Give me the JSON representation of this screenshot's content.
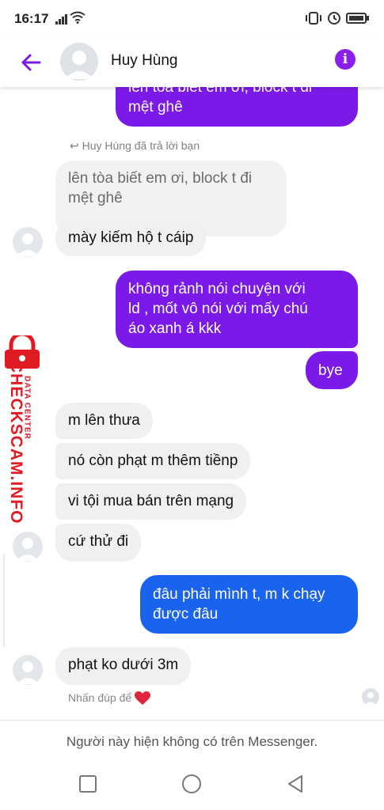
{
  "status": {
    "time": "16:17"
  },
  "header": {
    "contact_name": "Huy Hùng",
    "info_glyph": "i"
  },
  "reply_note": "Huy Hùng đã trả lời bạn",
  "messages": [
    {
      "side": "out",
      "text_l1": "lên tòa biết em ơi, block t đi",
      "text_l2": "mệt ghê"
    },
    {
      "side": "in-quoted",
      "text_l1": "lên tòa biết em ơi, block t đi",
      "text_l2": "mệt ghê"
    },
    {
      "side": "in",
      "text": "mày kiếm hộ t cáip"
    },
    {
      "side": "out",
      "text_l1": "không rảnh nói chuyện với",
      "text_l2": "ld , mốt vô nói với mấy chú",
      "text_l3": "áo xanh á kkk"
    },
    {
      "side": "out",
      "text": "bye"
    },
    {
      "side": "in",
      "text": "m lên thưa"
    },
    {
      "side": "in",
      "text": "nó còn phạt m thêm tiềnp"
    },
    {
      "side": "in",
      "text": "vi tội mua bán trên mạng"
    },
    {
      "side": "in",
      "text": "cứ thử đi"
    },
    {
      "side": "out",
      "text_l1": "đâu phải mình t, m k chạy",
      "text_l2": "được đâu"
    },
    {
      "side": "in",
      "text": "phạt ko dưới 3m"
    }
  ],
  "tap_note": "Nhấn đúp để",
  "footer_note": "Người này hiện không có trên Messenger.",
  "watermark": {
    "main": "CHECKSCAM.INFO",
    "sub": "DATA CENTER"
  },
  "colors": {
    "accent_purple": "#7b1ae8",
    "bubble_blue": "#1a63ef",
    "incoming_bg": "#f0f0f0",
    "watermark_red": "#e01b24"
  },
  "icons": [
    "back-arrow-icon",
    "info-icon",
    "reply-icon",
    "heart-icon",
    "lock-icon",
    "square-nav-icon",
    "circle-nav-icon",
    "triangle-back-nav-icon"
  ]
}
